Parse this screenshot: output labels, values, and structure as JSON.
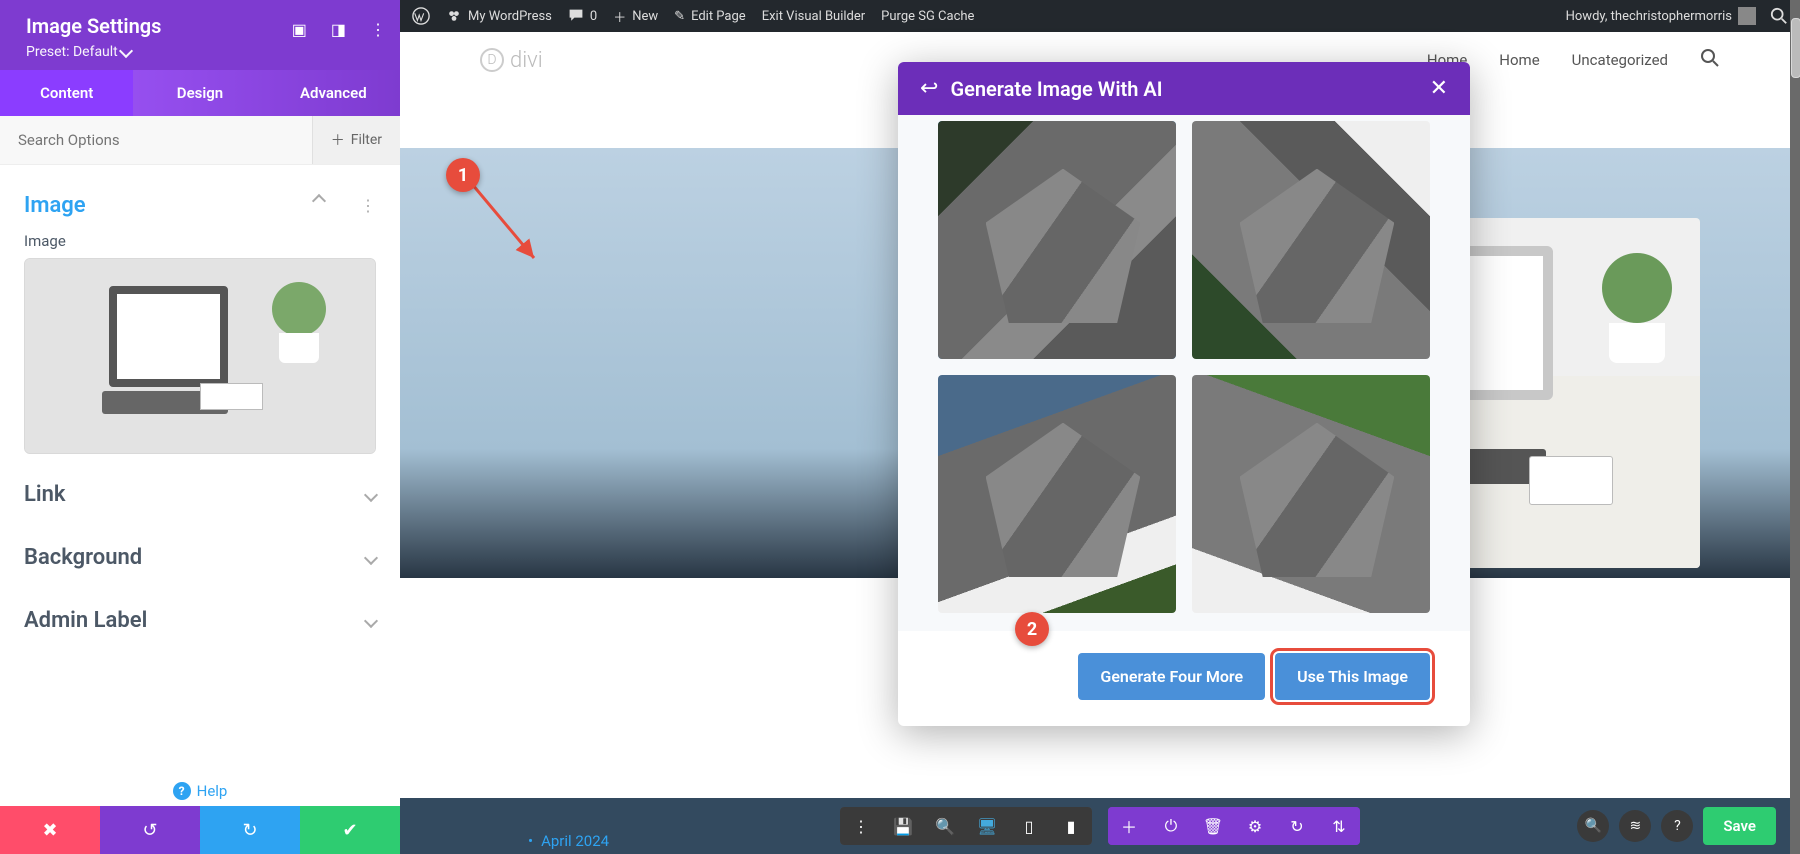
{
  "sidebar": {
    "title": "Image Settings",
    "preset": "Preset: Default",
    "tabs": {
      "content": "Content",
      "design": "Design",
      "advanced": "Advanced"
    },
    "search_placeholder": "Search Options",
    "filter_label": "Filter",
    "sections": {
      "image_title": "Image",
      "image_label": "Image",
      "link": "Link",
      "background": "Background",
      "admin_label": "Admin Label"
    },
    "help": "Help"
  },
  "wpbar": {
    "site": "My WordPress",
    "comments": "0",
    "new": "New",
    "edit": "Edit Page",
    "exit": "Exit Visual Builder",
    "purge": "Purge SG Cache",
    "howdy": "Howdy, thechristophermorris"
  },
  "sitenav": {
    "logo": "divi",
    "home1": "Home",
    "home2": "Home",
    "uncat": "Uncategorized"
  },
  "modal": {
    "title": "Generate Image With AI",
    "gen_more": "Generate Four More",
    "use": "Use This Image"
  },
  "builder": {
    "save": "Save"
  },
  "archive": {
    "text": "April 2024"
  },
  "annot": {
    "one": "1",
    "two": "2"
  }
}
